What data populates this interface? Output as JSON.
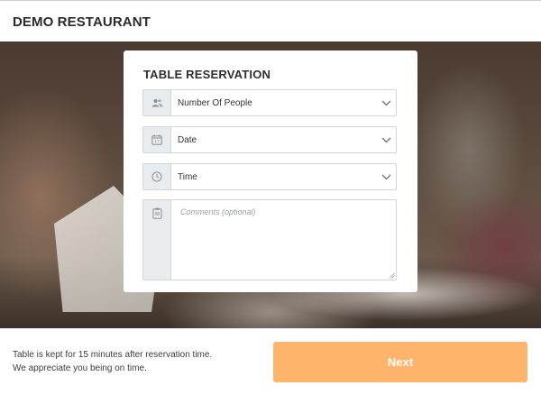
{
  "header": {
    "title": "DEMO RESTAURANT"
  },
  "form": {
    "title": "TABLE RESERVATION",
    "fields": [
      {
        "label": "Number Of People",
        "icon": "people-icon"
      },
      {
        "label": "Date",
        "icon": "calendar-icon",
        "icon_text": "17"
      },
      {
        "label": "Time",
        "icon": "clock-icon"
      }
    ],
    "comments_placeholder": "Comments (optional)"
  },
  "footer": {
    "note_line1": "Table is kept for 15 minutes after reservation time.",
    "note_line2": "We appreciate you being on time.",
    "next_label": "Next"
  },
  "colors": {
    "accent": "#ffb46b",
    "addon_bg": "#e9ecef",
    "border": "#d2d6da"
  }
}
